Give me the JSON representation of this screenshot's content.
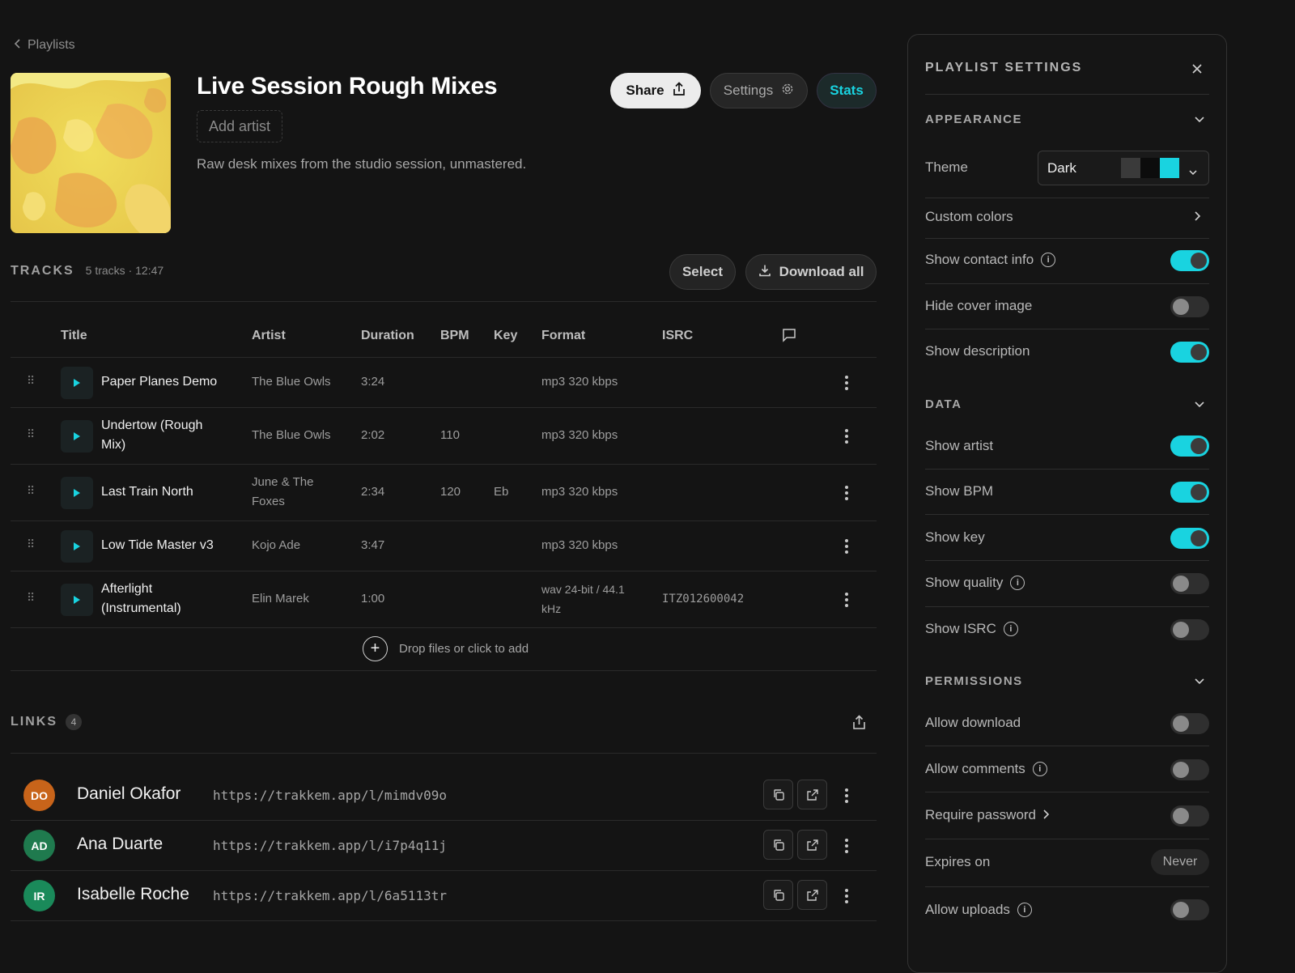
{
  "header": {
    "back_label": "Playlists",
    "title": "Live Session Rough Mixes",
    "add_artist": "Add artist",
    "description": "Raw desk mixes from the studio session, unmastered.",
    "share_label": "Share",
    "settings_label": "Settings",
    "stats_label": "Stats"
  },
  "tracks": {
    "label": "TRACKS",
    "summary": "5 tracks · 12:47",
    "select_label": "Select",
    "download_all_label": "Download all",
    "columns": {
      "title": "Title",
      "artist": "Artist",
      "duration": "Duration",
      "bpm": "BPM",
      "key": "Key",
      "format": "Format",
      "isrc": "ISRC"
    },
    "rows": [
      {
        "title": "Paper Planes Demo",
        "artist": "The Blue Owls",
        "duration": "3:24",
        "bpm": "",
        "key": "",
        "format": "mp3 320 kbps",
        "isrc": ""
      },
      {
        "title": "Undertow (Rough Mix)",
        "artist": "The Blue Owls",
        "duration": "2:02",
        "bpm": "110",
        "key": "",
        "format": "mp3 320 kbps",
        "isrc": ""
      },
      {
        "title": "Last Train North",
        "artist": "June & The Foxes",
        "duration": "2:34",
        "bpm": "120",
        "key": "Eb",
        "format": "mp3 320 kbps",
        "isrc": ""
      },
      {
        "title": "Low Tide Master v3",
        "artist": "Kojo Ade",
        "duration": "3:47",
        "bpm": "",
        "key": "",
        "format": "mp3 320 kbps",
        "isrc": ""
      },
      {
        "title": "Afterlight (Instrumental)",
        "artist": "Elin Marek",
        "duration": "1:00",
        "bpm": "",
        "key": "",
        "format": "wav 24-bit / 44.1 kHz",
        "isrc": "ITZ012600042"
      }
    ],
    "drop_label": "Drop files or click to add"
  },
  "links": {
    "label": "LINKS",
    "count": "4",
    "items": [
      {
        "initials": "DO",
        "name": "Daniel Okafor",
        "url": "https://trakkem.app/l/mimdv09o",
        "color": "#c8641a"
      },
      {
        "initials": "AD",
        "name": "Ana Duarte",
        "url": "https://trakkem.app/l/i7p4q11j",
        "color": "#1f7a4e"
      },
      {
        "initials": "IR",
        "name": "Isabelle Roche",
        "url": "https://trakkem.app/l/6a5113tr",
        "color": "#1a8a5a"
      }
    ]
  },
  "panel": {
    "title": "PLAYLIST SETTINGS",
    "appearance": {
      "label": "APPEARANCE",
      "theme_label": "Theme",
      "theme_value": "Dark",
      "custom_colors": "Custom colors",
      "show_contact_info": {
        "label": "Show contact info",
        "on": true
      },
      "hide_cover_image": {
        "label": "Hide cover image",
        "on": false
      },
      "show_description": {
        "label": "Show description",
        "on": true
      }
    },
    "data": {
      "label": "DATA",
      "show_artist": {
        "label": "Show artist",
        "on": true
      },
      "show_bpm": {
        "label": "Show BPM",
        "on": true
      },
      "show_key": {
        "label": "Show key",
        "on": true
      },
      "show_quality": {
        "label": "Show quality",
        "on": false
      },
      "show_isrc": {
        "label": "Show ISRC",
        "on": false
      }
    },
    "permissions": {
      "label": "PERMISSIONS",
      "allow_download": {
        "label": "Allow download",
        "on": false
      },
      "allow_comments": {
        "label": "Allow comments",
        "on": false
      },
      "require_password": {
        "label": "Require password",
        "on": false
      },
      "expires_on": {
        "label": "Expires on",
        "value": "Never"
      },
      "allow_uploads": {
        "label": "Allow uploads",
        "on": false
      }
    }
  },
  "colors": {
    "accent": "#19d3e0",
    "background": "#141414"
  }
}
